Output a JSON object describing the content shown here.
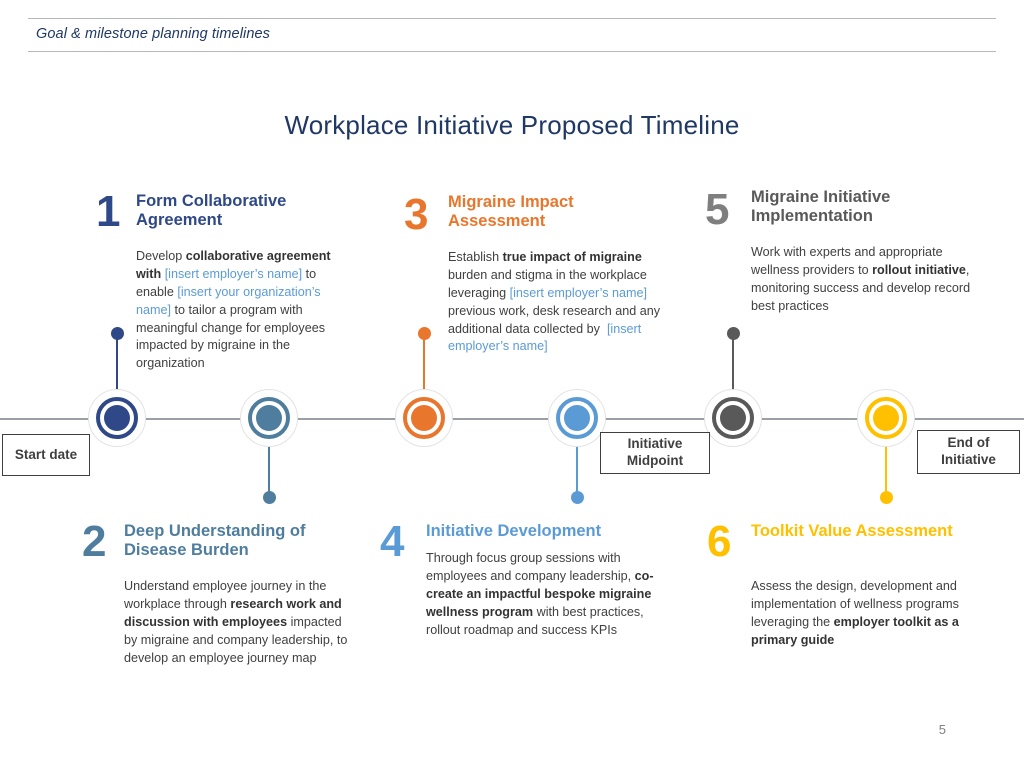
{
  "header": {
    "text": "Goal & milestone planning timelines"
  },
  "title": "Workplace Initiative Proposed Timeline",
  "page_number": "5",
  "colors": {
    "navy": "#2f4887",
    "steel_blue": "#4e7d9e",
    "orange": "#e8762c",
    "light_blue": "#5b9bd5",
    "gray": "#595959",
    "gold": "#ffc000",
    "axis": "#9aa0a6",
    "title_navy": "#1f3864",
    "placeholder_blue": "#5b9bd5"
  },
  "axis_labels": [
    {
      "id": "start-date",
      "text": "Start date"
    },
    {
      "id": "initiative-midpoint",
      "text": "Initiative Midpoint"
    },
    {
      "id": "end-of-initiative",
      "text": "End of Initiative"
    }
  ],
  "steps": [
    {
      "number": "1",
      "heading": "Form Collaborative Agreement",
      "color": "#2f4887",
      "position": "above",
      "body_html": "Develop <b>collaborative agreement with</b> <span class=\"ph\">[insert employer&rsquo;s name]</span> to enable <span class=\"ph\">[insert your organization&rsquo;s name]</span> to tailor a program with meaningful change for employees impacted by migraine in the organization",
      "body_text": "Develop collaborative agreement with [insert employer's name] to enable [insert your organization's name] to tailor a program with meaningful change for employees impacted by migraine in the organization"
    },
    {
      "number": "2",
      "heading": "Deep Understanding of Disease Burden",
      "color": "#4e7d9e",
      "position": "below",
      "body_html": "Understand employee journey in the workplace through <b>research work and discussion with employees</b> impacted by migraine and company leadership, to develop an employee journey map",
      "body_text": "Understand employee journey in the workplace through research work and discussion with employees impacted by migraine and company leadership, to develop an employee journey map"
    },
    {
      "number": "3",
      "heading": "Migraine Impact Assessment",
      "color": "#e8762c",
      "position": "above",
      "body_html": "Establish <b>true impact of migraine</b> burden and stigma in the workplace leveraging <span class=\"ph\">[insert employer&rsquo;s name]</span> previous work, desk research and any additional data collected by&nbsp; <span class=\"ph\">[insert employer&rsquo;s name]</span>",
      "body_text": "Establish true impact of migraine burden and stigma in the workplace leveraging [insert employer's name] previous work, desk research and any additional data collected by [insert employer's name]"
    },
    {
      "number": "4",
      "heading": "Initiative Development",
      "color": "#5b9bd5",
      "position": "below",
      "body_html": "Through focus group sessions with employees and company leadership, <b>co-create an impactful bespoke migraine wellness program</b> with best practices, rollout roadmap and success KPIs",
      "body_text": "Through focus group sessions with employees and company leadership, co-create an impactful bespoke migraine wellness program with best practices, rollout roadmap and success KPIs"
    },
    {
      "number": "5",
      "heading": "Migraine Initiative Implementation",
      "color": "#595959",
      "position": "above",
      "body_html": "Work with experts and appropriate wellness providers to <b>rollout initiative</b>, monitoring success and develop record best practices",
      "body_text": "Work with experts and appropriate wellness providers to rollout initiative, monitoring success and develop record best practices"
    },
    {
      "number": "6",
      "heading": "Toolkit Value Assessment",
      "color": "#ffc000",
      "position": "below",
      "body_html": "Assess the design, development and implementation of wellness programs leveraging the <b>employer toolkit as a primary guide</b>",
      "body_text": "Assess the design, development and implementation of wellness programs leveraging the employer toolkit as a primary guide"
    }
  ]
}
